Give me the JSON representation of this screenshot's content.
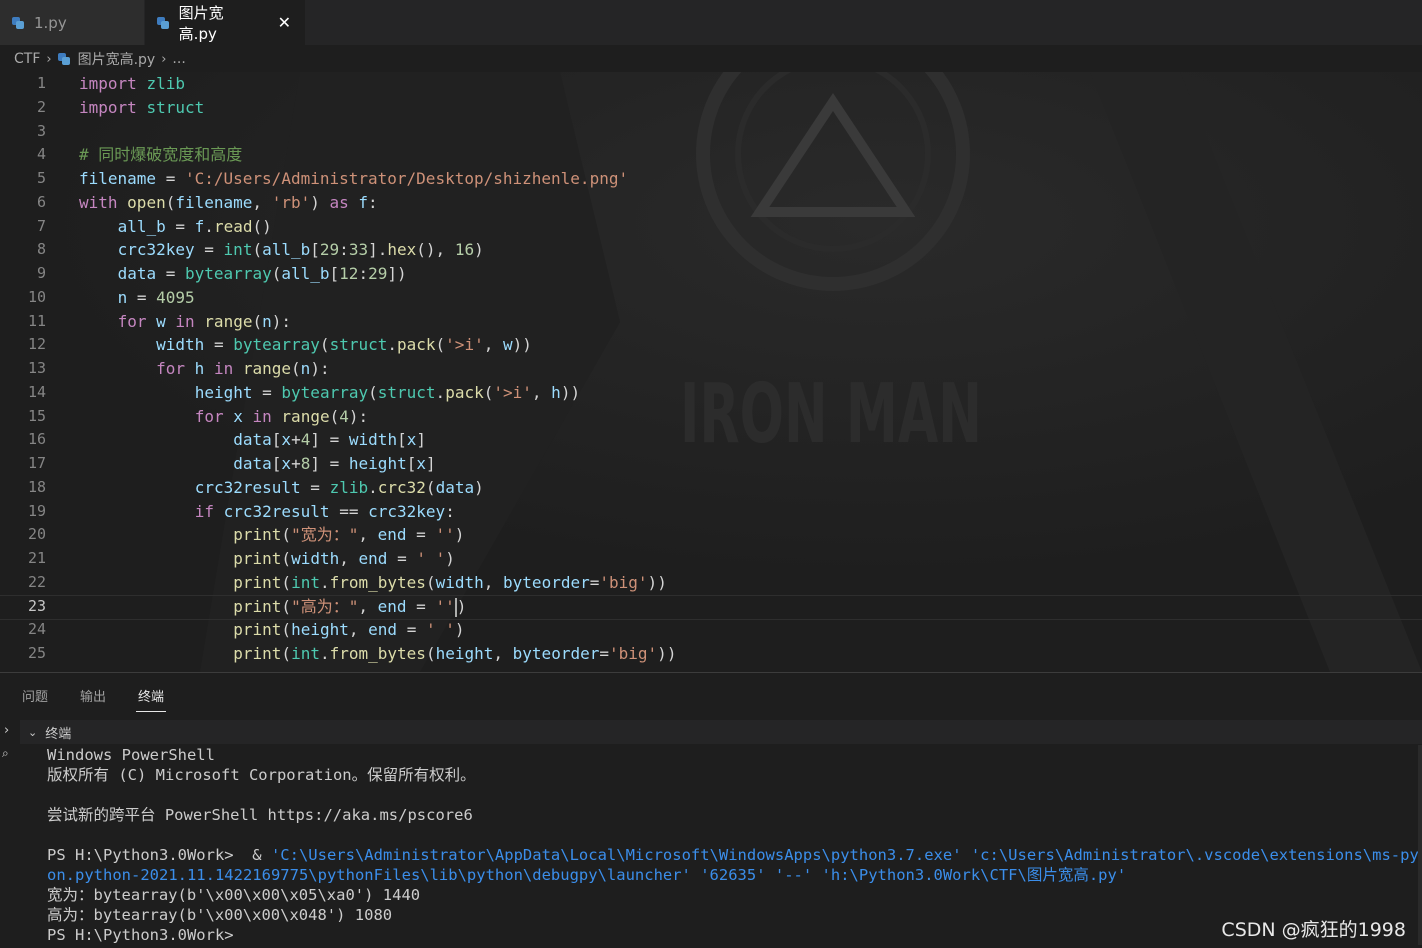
{
  "tabs": [
    {
      "label": "1.py",
      "active": false
    },
    {
      "label": "图片宽高.py",
      "active": true
    }
  ],
  "tab_close_glyph": "✕",
  "breadcrumb": {
    "root": "CTF",
    "file": "图片宽高.py",
    "more": "..."
  },
  "editor": {
    "current_line": 23,
    "background_text": "IRON MAN",
    "line_numbers": [
      "1",
      "2",
      "3",
      "4",
      "5",
      "6",
      "7",
      "8",
      "9",
      "10",
      "11",
      "12",
      "13",
      "14",
      "15",
      "16",
      "17",
      "18",
      "19",
      "20",
      "21",
      "22",
      "23",
      "24",
      "25"
    ],
    "lines": [
      "import zlib",
      "import struct",
      "",
      "# 同时爆破宽度和高度",
      "filename = 'C:/Users/Administrator/Desktop/shizhenle.png'",
      "with open(filename, 'rb') as f:",
      "    all_b = f.read()",
      "    crc32key = int(all_b[29:33].hex(), 16)",
      "    data = bytearray(all_b[12:29])",
      "    n = 4095",
      "    for w in range(n):",
      "        width = bytearray(struct.pack('>i', w))",
      "        for h in range(n):",
      "            height = bytearray(struct.pack('>i', h))",
      "            for x in range(4):",
      "                data[x+4] = width[x]",
      "                data[x+8] = height[x]",
      "            crc32result = zlib.crc32(data)",
      "            if crc32result == crc32key:",
      "                print(\"宽为：\", end = '')",
      "                print(width, end = ' ')",
      "                print(int.from_bytes(width, byteorder='big'))",
      "                print(\"高为：\", end = '')",
      "                print(height, end = ' ')",
      "                print(int.from_bytes(height, byteorder='big'))"
    ]
  },
  "panel": {
    "tabs": [
      {
        "label": "问题",
        "active": false
      },
      {
        "label": "输出",
        "active": false
      },
      {
        "label": "终端",
        "active": true
      }
    ],
    "terminal_title": "终端",
    "terminal_lines": [
      "Windows PowerShell",
      "版权所有 (C) Microsoft Corporation。保留所有权利。",
      "",
      "尝试新的跨平台 PowerShell https://aka.ms/pscore6",
      "",
      "PS H:\\Python3.0Work>  & 'C:\\Users\\Administrator\\AppData\\Local\\Microsoft\\WindowsApps\\python3.7.exe' 'c:\\Users\\Administrator\\.vscode\\extensions\\ms-pyth",
      "on.python-2021.11.1422169775\\pythonFiles\\lib\\python\\debugpy\\launcher' '62635' '--' 'h:\\Python3.0Work\\CTF\\图片宽高.py'",
      "宽为：bytearray(b'\\x00\\x00\\x05\\xa0') 1440",
      "高为：bytearray(b'\\x00\\x00\\x048') 1080",
      "PS H:\\Python3.0Work>"
    ]
  },
  "watermark": "CSDN @疯狂的1998",
  "colors": {
    "background": "#1e1e1e",
    "keyword": "#c586c0",
    "string": "#ce9178",
    "comment": "#6a9955",
    "number": "#b5cea8",
    "function": "#dcdcaa",
    "builtin_type": "#4ec9b0",
    "variable": "#9cdcfe",
    "terminal_path": "#3b8eea"
  }
}
